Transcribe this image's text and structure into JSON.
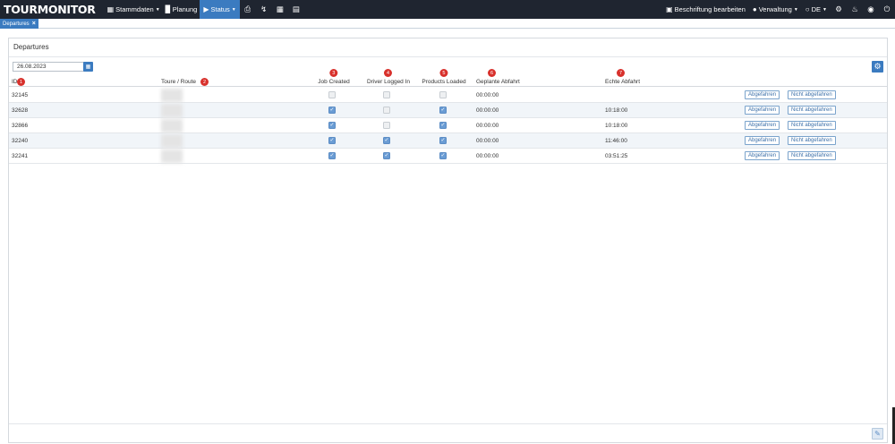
{
  "navbar": {
    "brand": "TOURMONITOR",
    "items": [
      {
        "label": "Stammdaten",
        "icon": "building-icon"
      },
      {
        "label": "Planung",
        "icon": "bar-chart-icon"
      },
      {
        "label": "Status",
        "icon": "video-icon"
      }
    ],
    "icons": [
      "printer-icon",
      "route-icon",
      "calculator-icon",
      "map-icon"
    ],
    "right": {
      "edit_labels": "Beschriftung bearbeiten",
      "admin": "Verwaltung",
      "language": "DE"
    }
  },
  "tabs": [
    {
      "label": "Departures"
    }
  ],
  "panel": {
    "title": "Departures",
    "date_value": "26.08.2023"
  },
  "table": {
    "headers": {
      "id": "ID",
      "route": "Toure / Route",
      "job_created": "Job Created",
      "driver_logged_in": "Driver Logged In",
      "products_loaded": "Products Loaded",
      "planned_departure": "Geplante Abfahrt",
      "actual_departure": "Echte Abfahrt"
    },
    "badges": [
      "1",
      "2",
      "3",
      "4",
      "5",
      "6",
      "7"
    ],
    "button_departed": "Abgefahren",
    "button_not_departed": "Nicht abgefahren",
    "rows": [
      {
        "id": "32145",
        "job_created": false,
        "driver_logged_in": false,
        "products_loaded": false,
        "planned": "00:00:00",
        "actual": ""
      },
      {
        "id": "32628",
        "job_created": true,
        "driver_logged_in": false,
        "products_loaded": true,
        "planned": "00:00:00",
        "actual": "10:18:00"
      },
      {
        "id": "32866",
        "job_created": true,
        "driver_logged_in": false,
        "products_loaded": true,
        "planned": "00:00:00",
        "actual": "10:18:00"
      },
      {
        "id": "32240",
        "job_created": true,
        "driver_logged_in": true,
        "products_loaded": true,
        "planned": "00:00:00",
        "actual": "11:46:00"
      },
      {
        "id": "32241",
        "job_created": true,
        "driver_logged_in": true,
        "products_loaded": true,
        "planned": "00:00:00",
        "actual": "03:51:25"
      }
    ]
  },
  "colors": {
    "navbar_bg": "#1f2530",
    "accent": "#3b7bc0",
    "badge": "#d8312c",
    "row_alt": "#f1f5f9"
  }
}
